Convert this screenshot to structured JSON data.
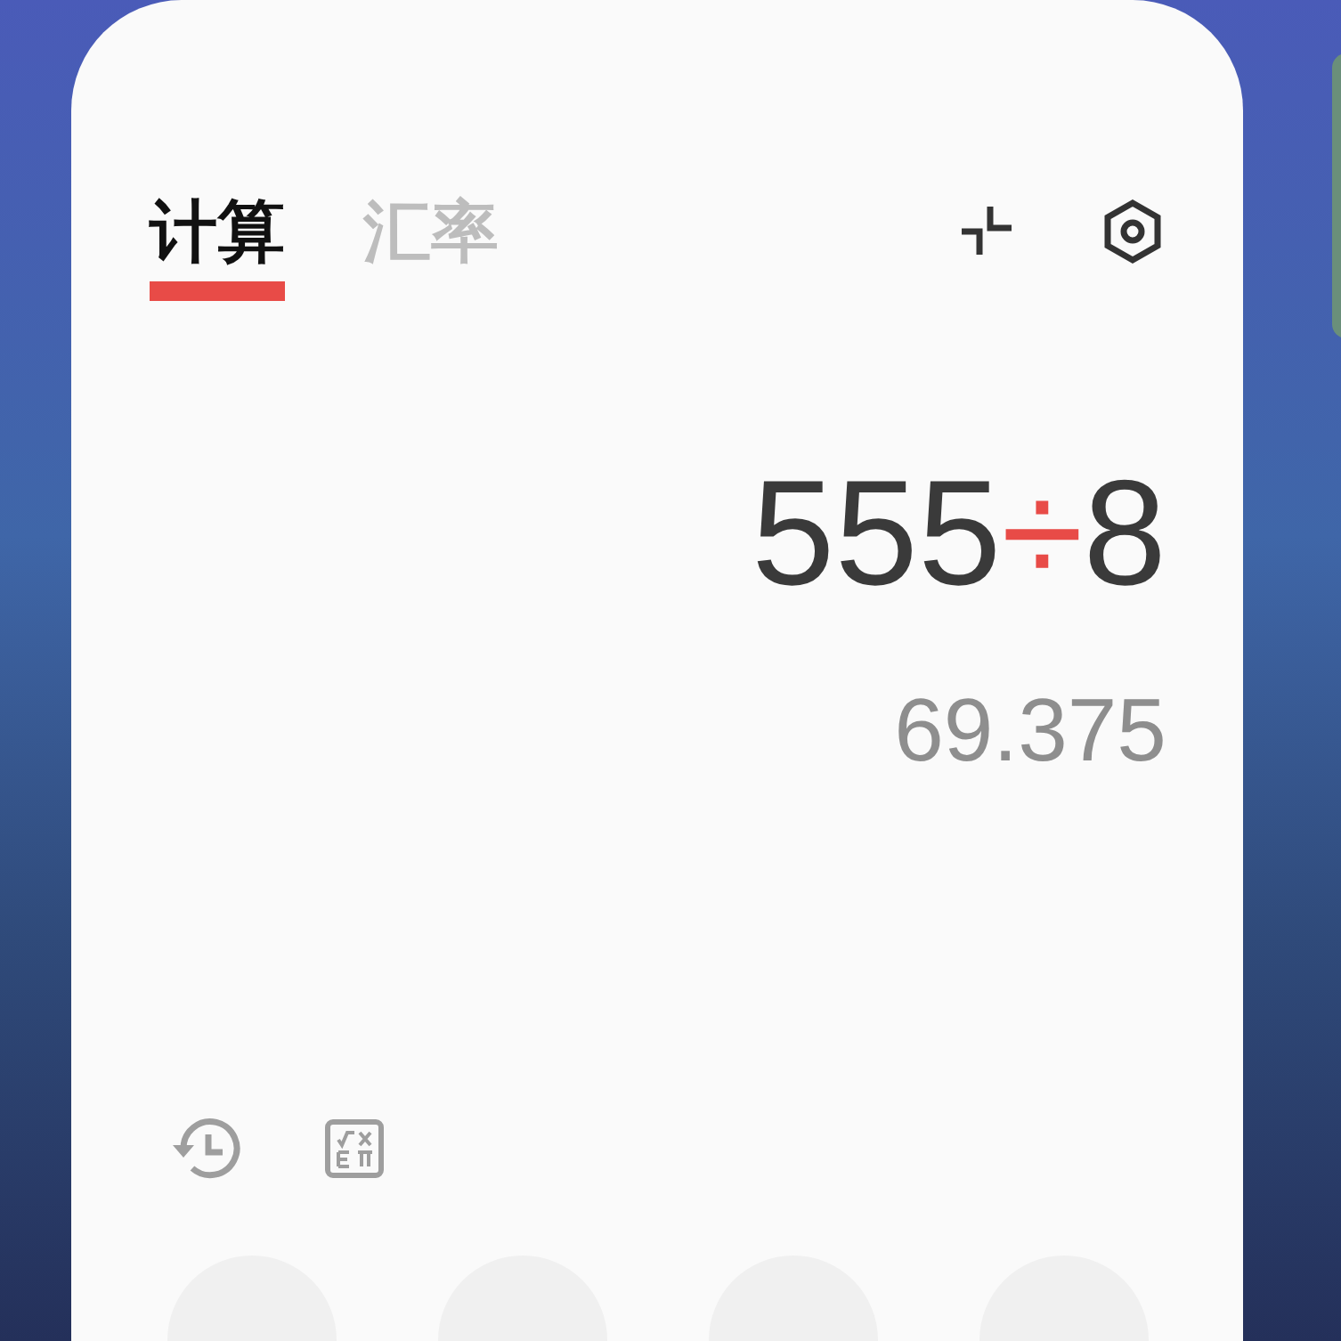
{
  "tabs": [
    {
      "label": "计算",
      "selected": true
    },
    {
      "label": "汇率",
      "selected": false
    }
  ],
  "display": {
    "expression": [
      {
        "text": "555",
        "kind": "number"
      },
      {
        "text": "÷",
        "kind": "operator"
      },
      {
        "text": "8",
        "kind": "number"
      }
    ],
    "result": "69.375"
  }
}
